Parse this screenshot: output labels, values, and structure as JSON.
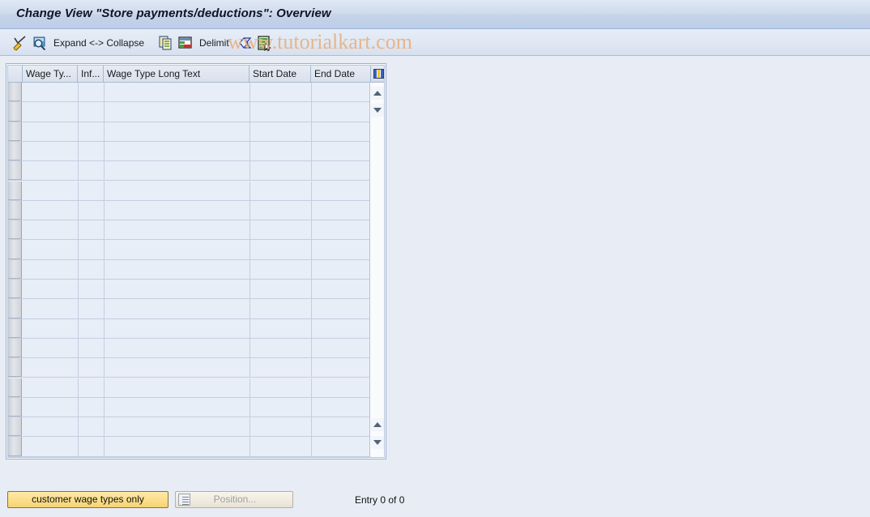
{
  "window": {
    "title": "Change View \"Store payments/deductions\": Overview"
  },
  "toolbar": {
    "items": [
      {
        "name": "check-pencil-icon",
        "label": ""
      },
      {
        "name": "display-magnifier-icon",
        "label": ""
      },
      {
        "name": "expand-collapse-button",
        "label": "Expand <-> Collapse"
      },
      {
        "name": "copy-as-icon",
        "label": ""
      },
      {
        "name": "delete-row-icon",
        "label": ""
      },
      {
        "name": "delimit-button",
        "label": "Delimit"
      },
      {
        "name": "select-all-diamond-icon",
        "label": ""
      },
      {
        "name": "select-block-icon",
        "label": ""
      }
    ]
  },
  "watermark": {
    "text": "www.tutorialkart.com",
    "color": "#e8b383"
  },
  "table": {
    "columns": [
      {
        "key": "selector",
        "label": ""
      },
      {
        "key": "wage_type",
        "label": "Wage Ty..."
      },
      {
        "key": "infotype",
        "label": "Inf..."
      },
      {
        "key": "wage_type_long_text",
        "label": "Wage Type Long Text"
      },
      {
        "key": "start_date",
        "label": "Start Date"
      },
      {
        "key": "end_date",
        "label": "End Date"
      }
    ],
    "rows": [],
    "visible_row_count": 19,
    "config_icon": "table-settings-icon",
    "scroll": {
      "top_up": "scroll-up-icon",
      "top_down": "scroll-down-icon",
      "bottom_up": "scroll-page-up-icon",
      "bottom_down": "scroll-page-down-icon"
    }
  },
  "footer": {
    "customer_wage_types_label": "customer wage types only",
    "position_label": "Position...",
    "position_icon": "position-list-icon",
    "entry_status": "Entry 0 of 0"
  },
  "colors": {
    "background": "#e8edf5",
    "title_bar": "#c6d4e8",
    "cell": "#e8eef7",
    "accent_button": "#fcdf8c",
    "grid_line": "#c3cee0"
  }
}
